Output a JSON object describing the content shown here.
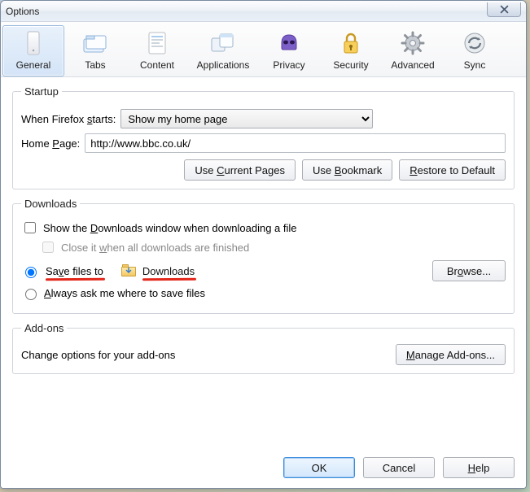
{
  "window": {
    "title": "Options"
  },
  "tabs": {
    "general": {
      "label": "General"
    },
    "tabs": {
      "label": "Tabs"
    },
    "content": {
      "label": "Content"
    },
    "applications": {
      "label": "Applications"
    },
    "privacy": {
      "label": "Privacy"
    },
    "security": {
      "label": "Security"
    },
    "advanced": {
      "label": "Advanced"
    },
    "sync": {
      "label": "Sync"
    }
  },
  "startup": {
    "legend": "Startup",
    "when_label_pre": "When Firefox ",
    "when_label_u": "s",
    "when_label_post": "tarts:",
    "when_value": "Show my home page",
    "home_label_pre": "Home ",
    "home_label_u": "P",
    "home_label_post": "age:",
    "home_value": "http://www.bbc.co.uk/",
    "btn_current_pre": "Use ",
    "btn_current_u": "C",
    "btn_current_post": "urrent Pages",
    "btn_bookmark_pre": "Use ",
    "btn_bookmark_u": "B",
    "btn_bookmark_post": "ookmark",
    "btn_restore_pre": "",
    "btn_restore_u": "R",
    "btn_restore_post": "estore to Default"
  },
  "downloads": {
    "legend": "Downloads",
    "chk_show_pre": "Show the ",
    "chk_show_u": "D",
    "chk_show_post": "ownloads window when downloading a file",
    "chk_close_pre": "Close it ",
    "chk_close_u": "w",
    "chk_close_post": "hen all downloads are finished",
    "radio_save_pre": "Sa",
    "radio_save_u": "v",
    "radio_save_post": "e files to",
    "folder": "Downloads",
    "browse_pre": "Br",
    "browse_u": "o",
    "browse_post": "wse...",
    "radio_ask_pre": "",
    "radio_ask_u": "A",
    "radio_ask_post": "lways ask me where to save files"
  },
  "addons": {
    "legend": "Add-ons",
    "desc": "Change options for your add-ons",
    "manage_pre": "",
    "manage_u": "M",
    "manage_post": "anage Add-ons..."
  },
  "footer": {
    "ok": "OK",
    "cancel": "Cancel",
    "help_u": "H",
    "help_post": "elp"
  }
}
